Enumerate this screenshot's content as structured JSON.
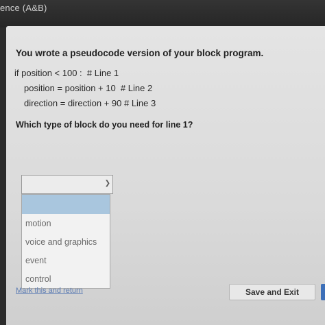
{
  "window": {
    "title": "ence (A&B)"
  },
  "question": {
    "title": "You wrote a pseudocode version of your block program.",
    "code_lines": [
      "if position < 100 :  # Line 1",
      "position = position + 10  # Line 2",
      "direction = direction + 90 # Line 3"
    ],
    "prompt": "Which type of block do you need for line 1?"
  },
  "select": {
    "selected_value": "",
    "options": [
      "motion",
      "voice and graphics",
      "event",
      "control"
    ]
  },
  "footer": {
    "mark_link": "Mark this and return",
    "save_label": "Save and Exit"
  },
  "colors": {
    "option_highlight": "#a9c6de",
    "next_button": "#3d6fb8"
  }
}
